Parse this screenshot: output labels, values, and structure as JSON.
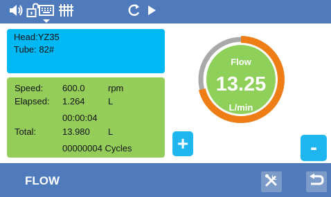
{
  "topbar": {
    "icons": [
      "speaker-icon",
      "unlock-icon",
      "keyboard-icon",
      "equalizer-icon",
      "refresh-icon",
      "play-icon"
    ]
  },
  "info": {
    "head_label": "Head:",
    "head_value": "YZ35",
    "tube_label": "Tube:",
    "tube_value": "82#"
  },
  "stats": {
    "speed_label": "Speed:",
    "speed_value": "600.0",
    "speed_unit": "rpm",
    "elapsed_label": "Elapsed:",
    "elapsed_value": "1.264",
    "elapsed_unit": "L",
    "elapsed_time": "00:00:04",
    "total_label": "Total:",
    "total_value": "13.980",
    "total_unit": "L",
    "cycles_value": "00000004",
    "cycles_label": "Cycles"
  },
  "gauge": {
    "label": "Flow",
    "value": "13.25",
    "unit": "L/min",
    "progress_fraction": 0.71,
    "colors": {
      "progress": "#ee7d16",
      "track": "#a9a9a9",
      "center": "#8fd05a"
    }
  },
  "controls": {
    "plus_label": "+",
    "minus_label": "-"
  },
  "bottombar": {
    "mode": "FLOW",
    "icons": [
      "tools-icon",
      "back-icon"
    ]
  },
  "colors": {
    "bar": "#4f7bbd",
    "info_bg": "#00b8f3",
    "stats_bg": "#94cd5a",
    "button": "#1fb6ef"
  }
}
